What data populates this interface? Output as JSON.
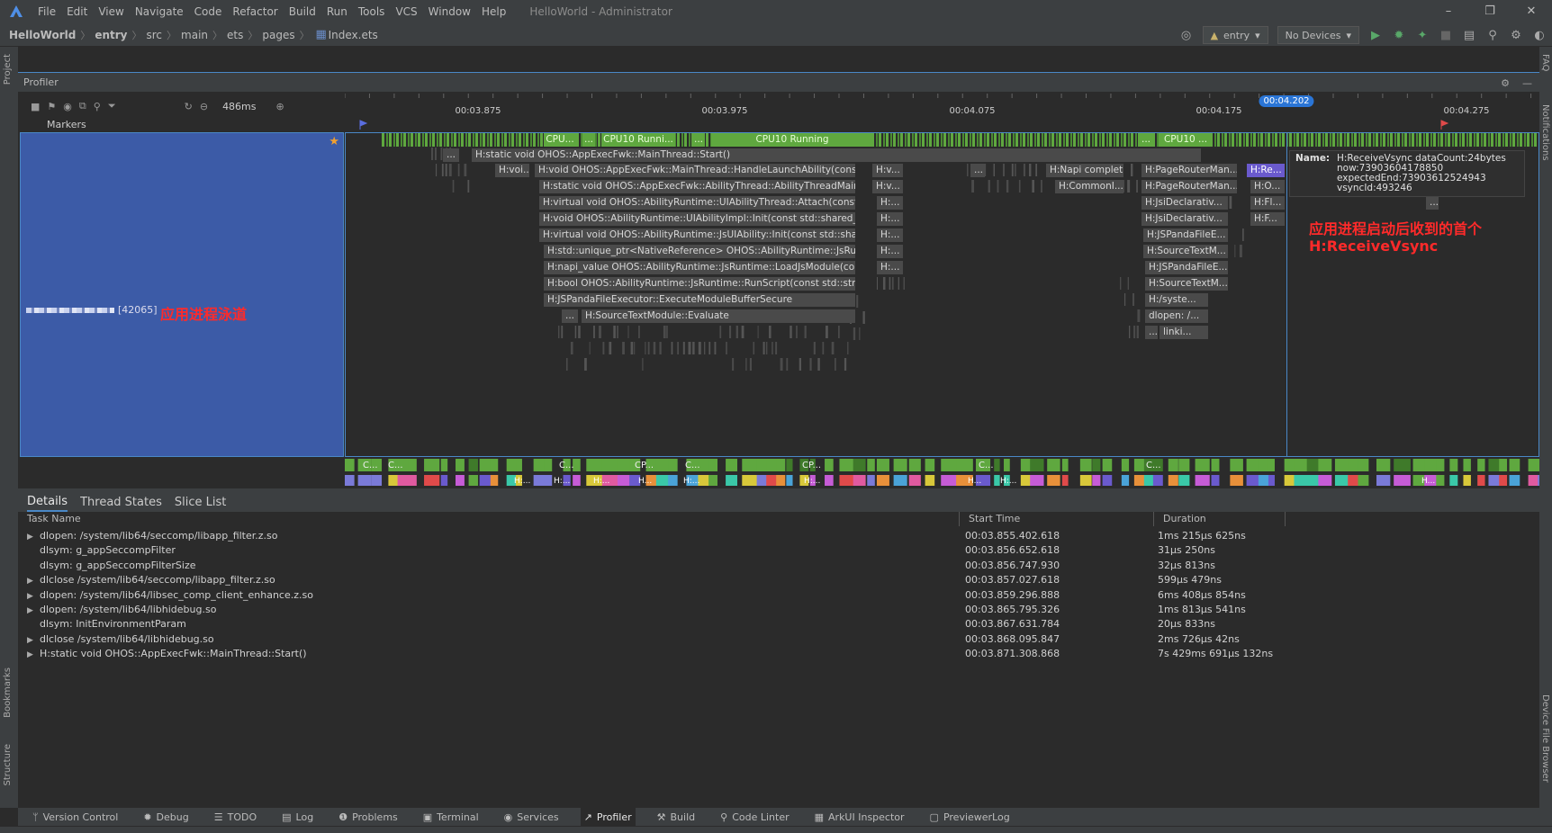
{
  "menubar": {
    "items": [
      "File",
      "Edit",
      "View",
      "Navigate",
      "Code",
      "Refactor",
      "Build",
      "Run",
      "Tools",
      "VCS",
      "Window",
      "Help"
    ],
    "window_title": "HelloWorld - Administrator",
    "controls": [
      "–",
      "❐",
      "✕"
    ]
  },
  "navbar": {
    "breadcrumbs": [
      "HelloWorld",
      "entry",
      "src",
      "main",
      "ets",
      "pages",
      "Index.ets"
    ],
    "module_combo": "entry",
    "device_combo": "No Devices"
  },
  "side_strips": {
    "project": "Project",
    "bookmarks": "Bookmarks",
    "structure": "Structure",
    "faq": "FAQ",
    "notifications": "Notifications",
    "device_file_browser": "Device File Browser"
  },
  "profiler": {
    "title": "Profiler",
    "zoom": "486ms",
    "ticks": [
      "00:03.875",
      "00:03.975",
      "00:04.075",
      "00:04.175",
      "00:04.275"
    ],
    "cursor_time": "00:04.202",
    "markers_label": "Markers",
    "lane_pid": "[42065]",
    "lane_annotation": "应用进程泳道",
    "vsync_annotation_line1": "应用进程启动后收到的首个",
    "vsync_annotation_line2": "H:ReceiveVsync",
    "cpu_labels": [
      "CPU...",
      "CPU10 Runni...",
      "CPU10 Running",
      "CPU10 ..."
    ],
    "ellipsis": "...",
    "slices": {
      "main_start": "H:static void OHOS::AppExecFwk::MainThread::Start()",
      "voi": "H:voi...",
      "handle_launch": "H:void OHOS::AppExecFwk::MainThread::HandleLaunchAbility(const std::s...",
      "ability_thread_main": "H:static void OHOS::AppExecFwk::AbilityThread::AbilityThreadMain(const ...",
      "ui_attach": "H:virtual void OHOS::AbilityRuntime::UIAbilityThread::Attach(const std::s...",
      "ui_impl_init": "H:void OHOS::AbilityRuntime::UIAbilityImpl::Init(const std::shared_ptr<A...",
      "js_ui_init": "H:virtual void OHOS::AbilityRuntime::JsUIAbility::Init(const std::shared_p...",
      "native_ref": "H:std::unique_ptr<NativeReference> OHOS::AbilityRuntime::JsRuntime:...",
      "load_js_module": "H:napi_value OHOS::AbilityRuntime::JsRuntime::LoadJsModule(const st...",
      "run_script": "H:bool OHOS::AbilityRuntime::JsRuntime::RunScript(const std::string &,...",
      "execute_buffer": "H:JSPandaFileExecutor::ExecuteModuleBufferSecure",
      "source_evaluate": "H:SourceTextModule::Evaluate",
      "hv1": "H:v...",
      "hv2": "H:v...",
      "hdot1": "H:...",
      "hdot2": "H:...",
      "hdot3": "H:...",
      "hdot4": "H:...",
      "hdot5": "H:...",
      "napi_complete": "H:Napi complet...",
      "common": "H:CommonI...",
      "page_router1": "H:PageRouterMan...",
      "page_router2": "H:PageRouterMan...",
      "jsi_decl1": "H:JsiDeclarativ...",
      "jsi_decl2": "H:JsiDeclarativ...",
      "panda_file1": "H:JSPandaFileE...",
      "source_text1": "H:SourceTextM...",
      "panda_file2": "H:JSPandaFileE...",
      "source_text2": "H:SourceTextM...",
      "syste": "H:/syste...",
      "dlopen": "dlopen: /...",
      "linki": "linki...",
      "hre": "H:Re...",
      "ho": "H:O...",
      "hfl": "H:Fl...",
      "hf": "H:F..."
    },
    "tooltip": {
      "key": "Name:",
      "line1": "H:ReceiveVsync dataCount:24bytes",
      "line2": "now:73903604178850",
      "line3": "expectedEnd:73903612524943",
      "line4": "vsyncId:493246"
    },
    "cpu_lane_labels": [
      "C...",
      "C...",
      "C...",
      "CP...",
      "C...",
      "CP...",
      "C...",
      "C...",
      "H:...",
      "H:...",
      "H:...",
      "H...",
      "H:...",
      "H:...",
      "H...",
      "H:...",
      "H..."
    ]
  },
  "details": {
    "tabs": [
      "Details",
      "Thread States",
      "Slice List"
    ],
    "columns": [
      "Task Name",
      "Start Time",
      "Duration"
    ],
    "rows": [
      {
        "name": "dlopen: /system/lib64/seccomp/libapp_filter.z.so",
        "start": "00:03.855.402.618",
        "duration": "1ms 215μs 625ns",
        "expand": true
      },
      {
        "name": "dlsym: g_appSeccompFilter",
        "start": "00:03.856.652.618",
        "duration": "31μs 250ns",
        "expand": false
      },
      {
        "name": "dlsym: g_appSeccompFilterSize",
        "start": "00:03.856.747.930",
        "duration": "32μs 813ns",
        "expand": false
      },
      {
        "name": "dlclose /system/lib64/seccomp/libapp_filter.z.so",
        "start": "00:03.857.027.618",
        "duration": "599μs 479ns",
        "expand": true
      },
      {
        "name": "dlopen: /system/lib64/libsec_comp_client_enhance.z.so",
        "start": "00:03.859.296.888",
        "duration": "6ms 408μs 854ns",
        "expand": true
      },
      {
        "name": "dlopen: /system/lib64/libhidebug.so",
        "start": "00:03.865.795.326",
        "duration": "1ms 813μs 541ns",
        "expand": true
      },
      {
        "name": "dlsym: InitEnvironmentParam",
        "start": "00:03.867.631.784",
        "duration": "20μs 833ns",
        "expand": false
      },
      {
        "name": "dlclose /system/lib64/libhidebug.so",
        "start": "00:03.868.095.847",
        "duration": "2ms 726μs 42ns",
        "expand": true
      },
      {
        "name": "H:static void OHOS::AppExecFwk::MainThread::Start()",
        "start": "00:03.871.308.868",
        "duration": "7s 429ms 691μs 132ns",
        "expand": true
      }
    ]
  },
  "tool_tabs": [
    "Version Control",
    "Debug",
    "TODO",
    "Log",
    "Problems",
    "Terminal",
    "Services",
    "Profiler",
    "Build",
    "Code Linter",
    "ArkUI Inspector",
    "PreviewerLog"
  ],
  "colors": {
    "accent": "#4a88c7",
    "lane_bg": "#3c5ba7",
    "cpu_green": "#5fa83f",
    "annotation_red": "#ff2a2a"
  }
}
